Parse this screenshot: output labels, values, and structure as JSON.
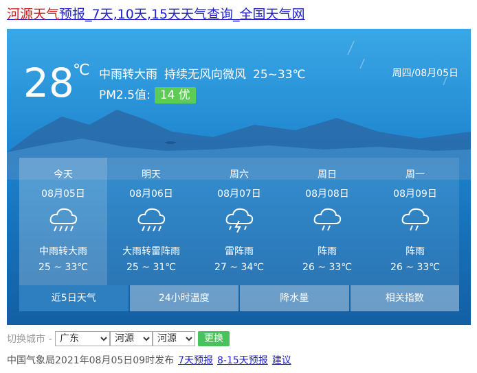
{
  "header": {
    "title_part1": "河源天气",
    "title_part2": "预报_7天,10天,15天天气查询_全国天气网"
  },
  "current": {
    "temperature": "28",
    "unit": "℃",
    "weather": "中雨转大雨",
    "wind": "持续无风向微风",
    "range": "25~33℃",
    "date": "周四/08月05日",
    "pm_label": "PM2.5值:",
    "pm_value": "14 优",
    "pm_color": "#5dcc55"
  },
  "forecast": [
    {
      "name": "今天",
      "date": "08月05日",
      "icon": "rain-icon",
      "weather": "中雨转大雨",
      "temp": "25 ~ 33℃"
    },
    {
      "name": "明天",
      "date": "08月06日",
      "icon": "rain-icon",
      "weather": "大雨转雷阵雨",
      "temp": "25 ~ 31℃"
    },
    {
      "name": "周六",
      "date": "08月07日",
      "icon": "thunderstorm-icon",
      "weather": "雷阵雨",
      "temp": "27 ~ 34℃"
    },
    {
      "name": "周日",
      "date": "08月08日",
      "icon": "shower-icon",
      "weather": "阵雨",
      "temp": "26 ~ 33℃"
    },
    {
      "name": "周一",
      "date": "08月09日",
      "icon": "shower-icon",
      "weather": "阵雨",
      "temp": "26 ~ 33℃"
    }
  ],
  "tabs": [
    "近5日天气",
    "24小时温度",
    "降水量",
    "相关指数"
  ],
  "switch": {
    "label": "切换城市 -",
    "province": "广东",
    "city": "河源",
    "district": "河源",
    "button": "更换"
  },
  "footer": {
    "published": "中国气象局2021年08月05日09时发布",
    "link1": "7天预报",
    "link2": "8-15天预报",
    "link3": "建议"
  },
  "colors": {
    "accent_green": "#48c25c",
    "link": "#2222cc",
    "title_red": "#cc2222"
  }
}
